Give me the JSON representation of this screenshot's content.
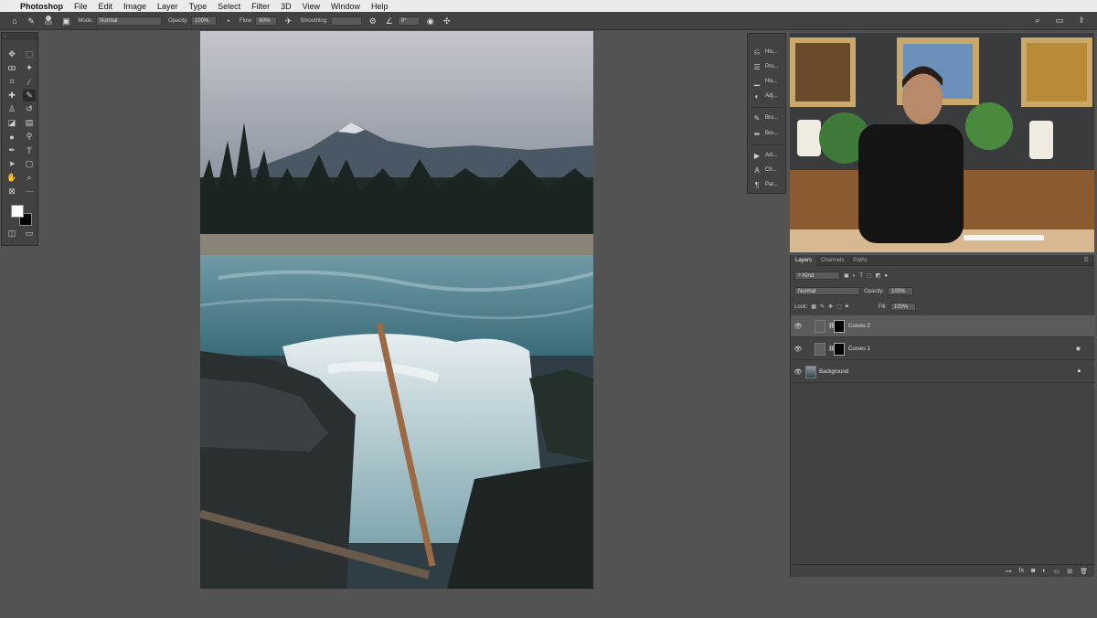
{
  "menubar": {
    "apple_icon": "apple-icon",
    "app_name": "Photoshop",
    "items": [
      "File",
      "Edit",
      "Image",
      "Layer",
      "Type",
      "Select",
      "Filter",
      "3D",
      "View",
      "Window",
      "Help"
    ]
  },
  "options_bar": {
    "brush_size": "620",
    "mode_label": "Mode:",
    "mode_value": "Normal",
    "opacity_label": "Opacity:",
    "opacity_value": "100%",
    "flow_label": "Flow:",
    "flow_value": "60%",
    "smoothing_label": "Smoothing:",
    "smoothing_value": "",
    "angle_value": "0°"
  },
  "panel_strip": {
    "items": [
      {
        "icon": "history-icon",
        "label": "His..."
      },
      {
        "icon": "properties-icon",
        "label": "Pro..."
      },
      {
        "icon": "histogram-icon",
        "label": "His..."
      },
      {
        "icon": "adjustments-icon",
        "label": "Adj..."
      },
      {
        "icon": "brush-icon",
        "label": "Bru..."
      },
      {
        "icon": "brush-settings-icon",
        "label": "Bru..."
      },
      {
        "icon": "actions-icon",
        "label": "Act..."
      },
      {
        "icon": "character-icon",
        "label": "Ch..."
      },
      {
        "icon": "paragraph-icon",
        "label": "Par..."
      }
    ]
  },
  "layers_panel": {
    "tabs": [
      "Layers",
      "Channels",
      "Paths"
    ],
    "active_tab": "Layers",
    "filter_kind": "Kind",
    "blend_mode": "Normal",
    "opacity_label": "Opacity:",
    "opacity_value": "100%",
    "lock_label": "Lock:",
    "fill_label": "Fill:",
    "fill_value": "100%",
    "layers": [
      {
        "name": "Curves 2",
        "selected": true
      },
      {
        "name": "Curves 1",
        "selected": false
      },
      {
        "name": "Background",
        "selected": false
      }
    ],
    "footer_icons": [
      "link-icon",
      "fx-icon",
      "mask-icon",
      "adjustment-layer-icon",
      "group-icon",
      "new-layer-icon",
      "trash-icon"
    ]
  },
  "colors": {
    "foreground": "#ffffff",
    "background": "#000000",
    "ui_dark": "#424242",
    "workspace": "#535353"
  }
}
